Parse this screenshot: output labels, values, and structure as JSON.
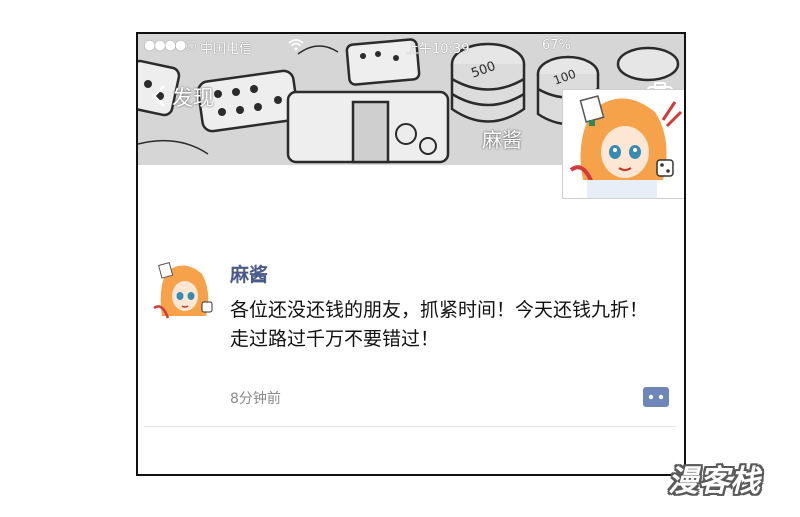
{
  "status_bar": {
    "signal": "●●●●○",
    "carrier": "中国电信",
    "time": "上午10:39",
    "battery": "67%"
  },
  "nav": {
    "back_label": "发现"
  },
  "profile": {
    "name": "麻酱"
  },
  "post": {
    "author": "麻酱",
    "text": "各位还没还钱的朋友，抓紧时间！今天还钱九折！走过路过千万不要错过！",
    "time": "8分钟前"
  },
  "icons": {
    "back": "chevron-left-icon",
    "camera": "camera-icon",
    "wifi": "wifi-icon",
    "comment": "comment-icon"
  },
  "colors": {
    "author_name": "#4a5a8c",
    "comment_icon": "#6f86b8",
    "cover_bg": "#d9d9d9"
  },
  "watermark": {
    "text": "漫客栈"
  }
}
